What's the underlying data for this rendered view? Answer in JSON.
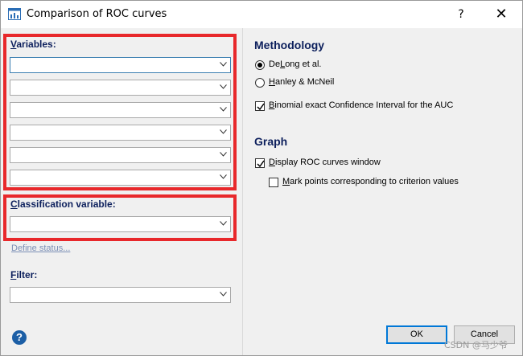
{
  "window": {
    "title": "Comparison of ROC curves",
    "help_glyph": "?",
    "close_glyph": "✕"
  },
  "variables": {
    "label_u": "V",
    "label_rest": "ariables:",
    "dropdown_count": 6,
    "values": [
      "",
      "",
      "",
      "",
      "",
      ""
    ]
  },
  "classification": {
    "label_u": "C",
    "label_rest": "lassification variable:",
    "value": ""
  },
  "define_status": "Define status...",
  "filter": {
    "label_u": "F",
    "label_rest": "ilter:",
    "value": ""
  },
  "methodology": {
    "title": "Methodology",
    "options": [
      {
        "pre": "De",
        "u": "L",
        "post": "ong et al.",
        "selected": true
      },
      {
        "pre": "",
        "u": "H",
        "post": "anley & McNeil",
        "selected": false
      }
    ],
    "binomial": {
      "pre": "",
      "u": "B",
      "post": "inomial exact Confidence Interval for the AUC",
      "checked": true
    }
  },
  "graph": {
    "title": "Graph",
    "display_roc": {
      "pre": "",
      "u": "D",
      "post": "isplay ROC curves window",
      "checked": true
    },
    "mark_points": {
      "pre": "",
      "u": "M",
      "post": "ark points corresponding to criterion values",
      "checked": false
    }
  },
  "buttons": {
    "help": "?",
    "ok": "OK",
    "cancel": "Cancel"
  },
  "watermark": "CSDN @马少爷",
  "colors": {
    "highlight_border": "#e8282b",
    "section_title": "#0c1f5c",
    "link": "#7b8fb6",
    "help_icon": "#1c5fa6"
  }
}
